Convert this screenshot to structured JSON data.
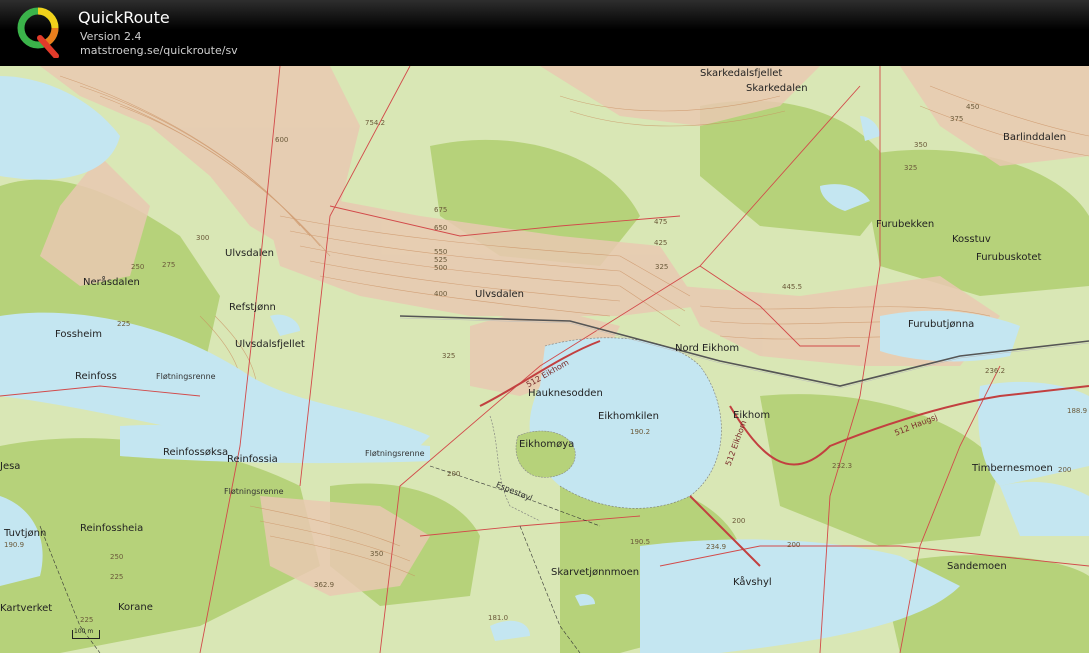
{
  "app": {
    "title": "QuickRoute",
    "version": "Version 2.4",
    "url": "matstroeng.se/quickroute/sv"
  },
  "colors": {
    "water": "#c4e6f1",
    "open_land": "#d9e7b5",
    "forest": "#b6d27a",
    "slope": "#e9c9b2",
    "contour": "#c98d5e",
    "road": "#d24a4a",
    "route": "#555555"
  },
  "map": {
    "places": {
      "skarkedalsfjellet": "Skarkedalsfjellet",
      "skarkedalen": "Skarkedalen",
      "barlinddalen": "Barlinddalen",
      "furubekken": "Furubekken",
      "kosstuv": "Kosstuv",
      "furubuskotet": "Furubuskotet",
      "furubutjonna": "Furubutjønna",
      "ulvsdalen_w": "Ulvsdalen",
      "ulvsdalen_c": "Ulvsdalen",
      "nerasdalen": "Neråsdalen",
      "refstjonn": "Refstjønn",
      "ulvsdalsfjellet": "Ulvsdalsfjellet",
      "fossheim": "Fossheim",
      "reinfoss": "Reinfoss",
      "flotningsrenne_1": "Fløtningsrenne",
      "flotningsrenne_2": "Fløtningsrenne",
      "flotningsrenne_3": "Fløtningsrenne",
      "nord_eikhom": "Nord Eikhom",
      "hauknesodden": "Hauknesodden",
      "eikhomkilen": "Eikhomkilen",
      "eikhom": "Eikhom",
      "eikhomoya": "Eikhomøya",
      "reinfossoksa": "Reinfossøksa",
      "reinfossia": "Reinfossia",
      "timbernesmoen": "Timbernesmoen",
      "espestoyl": "Espestøyl",
      "jesa": "Jesa",
      "reinfossheia": "Reinfossheia",
      "tuvtjonn": "Tuvtjønn",
      "skarvetjonnmoen": "Skarvetjønnmoen",
      "kavshyl": "Kåvshyl",
      "sandemoen": "Sandemoen",
      "korane": "Korane",
      "kartverket": "Kartverket"
    },
    "roads": {
      "r512_a": "512 Eikhom",
      "r512_b": "512 Eikhom",
      "r512_c": "512 Haugsj"
    },
    "elevations": {
      "e754": "754.2",
      "e445": "445.5",
      "e236": "236.2",
      "e188": "188.9",
      "e232": "232.3",
      "e190_2": "190.2",
      "e190_5": "190.5",
      "e234": "234.9",
      "e362": "362.9",
      "e200_a": "200",
      "e200_b": "200",
      "e200_c": "200",
      "e200_d": "200",
      "e225_a": "225",
      "e225_b": "225",
      "e225_c": "225",
      "e250_a": "250",
      "e250_b": "250",
      "e275": "275",
      "e300": "300",
      "e325_a": "325",
      "e325_b": "325",
      "e325_c": "325",
      "e350_a": "350",
      "e350_b": "350",
      "e375": "375",
      "e400": "400",
      "e425": "425",
      "e450": "450",
      "e475": "475",
      "e500": "500",
      "e525": "525",
      "e550": "550",
      "e650": "650",
      "e675": "675",
      "e600": "600",
      "e190_9": "190.9",
      "e181": "181.0"
    },
    "scale": "100 m"
  }
}
